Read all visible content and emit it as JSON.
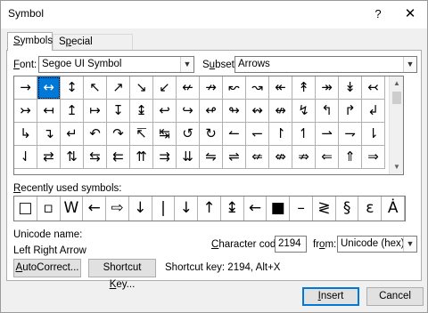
{
  "window": {
    "title": "Symbol",
    "help_glyph": "?",
    "close_glyph": "✕"
  },
  "tabs": [
    {
      "label": "Symbols",
      "hotkey": "S",
      "rest": "ymbols",
      "active": true
    },
    {
      "label": "Special Characters",
      "pre": "S",
      "hotkey": "p",
      "rest": "ecial Characters",
      "active": false
    }
  ],
  "font": {
    "label_hot": "F",
    "label_rest": "ont:",
    "value": "Segoe UI Symbol"
  },
  "subset": {
    "label_pre": "S",
    "label_hot": "u",
    "label_rest": "bset:",
    "value": "Arrows"
  },
  "grid_rows": [
    [
      "→",
      "↔",
      "↕",
      "↖",
      "↗",
      "↘",
      "↙",
      "↚",
      "↛",
      "↜",
      "↝",
      "↞",
      "↟",
      "↠",
      "↡",
      "↢"
    ],
    [
      "↣",
      "↤",
      "↥",
      "↦",
      "↧",
      "↨",
      "↩",
      "↪",
      "↫",
      "↬",
      "↭",
      "↮",
      "↯",
      "↰",
      "↱",
      "↲"
    ],
    [
      "↳",
      "↴",
      "↵",
      "↶",
      "↷",
      "↸",
      "↹",
      "↺",
      "↻",
      "↼",
      "↽",
      "↾",
      "↿",
      "⇀",
      "⇁",
      "⇂"
    ],
    [
      "⇃",
      "⇄",
      "⇅",
      "⇆",
      "⇇",
      "⇈",
      "⇉",
      "⇊",
      "⇋",
      "⇌",
      "⇍",
      "⇎",
      "⇏",
      "⇐",
      "⇑",
      "⇒"
    ]
  ],
  "selected": {
    "row": 0,
    "col": 1
  },
  "recent": {
    "label_pre": "",
    "label_hot": "R",
    "label_rest": "ecently used symbols:",
    "symbols": [
      "□",
      "▫",
      "W",
      "←",
      "⇨",
      "↓",
      "|",
      "↓",
      "↑",
      "↨",
      "←",
      "■",
      "–",
      "≷",
      "§",
      "ε",
      "Ȧ"
    ]
  },
  "unicode_name": {
    "label": "Unicode name:",
    "value": "Left Right Arrow"
  },
  "char_code": {
    "label_pre": "",
    "label_hot": "C",
    "label_rest": "haracter code:",
    "value": "2194"
  },
  "from": {
    "label_pre": "fr",
    "label_hot": "o",
    "label_rest": "m:",
    "value": "Unicode (hex)"
  },
  "buttons": {
    "autocorrect": {
      "pre": "",
      "hot": "A",
      "rest": "utoCorrect..."
    },
    "shortcut_key": {
      "pre": "Shortcut ",
      "hot": "K",
      "rest": "ey..."
    },
    "insert": {
      "pre": "",
      "hot": "I",
      "rest": "nsert"
    },
    "cancel": {
      "label": "Cancel"
    }
  },
  "shortcut_text": "Shortcut key: 2194, Alt+X",
  "icons": {
    "dropdown": "chevron-down-icon",
    "scroll_up": "scroll-up-icon",
    "scroll_down": "scroll-down-icon"
  }
}
